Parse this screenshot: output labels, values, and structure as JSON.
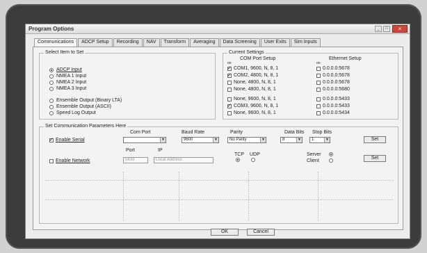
{
  "window": {
    "title": "Program Options",
    "close_glyph": "×",
    "min_glyph": "_",
    "max_glyph": "□"
  },
  "tabs": [
    "Communications",
    "ADCP Setup",
    "Recording",
    "NAV",
    "Transform",
    "Averaging",
    "Data Screening",
    "User Exits",
    "Sim Inputs"
  ],
  "select_group": {
    "label": "Select Item to Set",
    "items": [
      "ADCP Input",
      "NMEA 1 Input",
      "NMEA 2 Input",
      "NMEA 3 Input",
      "Ensemble Output (Binary LTA)",
      "Ensemble Output (ASCII)",
      "Speed Log Output"
    ]
  },
  "current_settings": {
    "label": "Current Settings",
    "com_header": "COM Port Setup",
    "eth_header": "Ethernet Setup",
    "on_label": "on",
    "rows": [
      {
        "com": "COM1,  9600, N, 8, 1",
        "eth": "0.0.0.0:5678"
      },
      {
        "com": "COM2,  4800, N, 8, 1",
        "eth": "0.0.0.0:5678"
      },
      {
        "com": "None,  4800, N, 8, 1",
        "eth": "0.0.0.0:5678"
      },
      {
        "com": "None,  4800, N, 8, 1",
        "eth": "0.0.0.0:5680"
      },
      {
        "com": "None,  9600, N, 8, 1",
        "eth": "0.0.0.0:5433"
      },
      {
        "com": "COM3,  9600, N, 8, 1",
        "eth": "0.0.0.0:5433"
      },
      {
        "com": "None,  9600, N, 8, 1",
        "eth": "0.0.0.0:5434"
      }
    ]
  },
  "params": {
    "label": "Set Communication Parameters Here",
    "serial": {
      "enable_label": "Enable Serial",
      "com_port_label": "Com Port",
      "com_port_value": "",
      "baud_label": "Baud Rate",
      "baud_value": "9600",
      "parity_label": "Parity",
      "parity_value": "No Parity",
      "data_bits_label": "Data Bits",
      "data_bits_value": "8",
      "stop_bits_label": "Stop Bits",
      "stop_bits_value": "1",
      "set_label": "Set"
    },
    "network": {
      "enable_label": "Enable Network",
      "port_label": "Port",
      "port_value": "5433",
      "ip_label": "IP",
      "ip_value": "Local Address",
      "tcp_label": "TCP",
      "udp_label": "UDP",
      "server_label": "Server",
      "client_label": "Client",
      "set_label": "Set"
    }
  },
  "footer": {
    "ok_label": "OK",
    "cancel_label": "Cancel"
  }
}
